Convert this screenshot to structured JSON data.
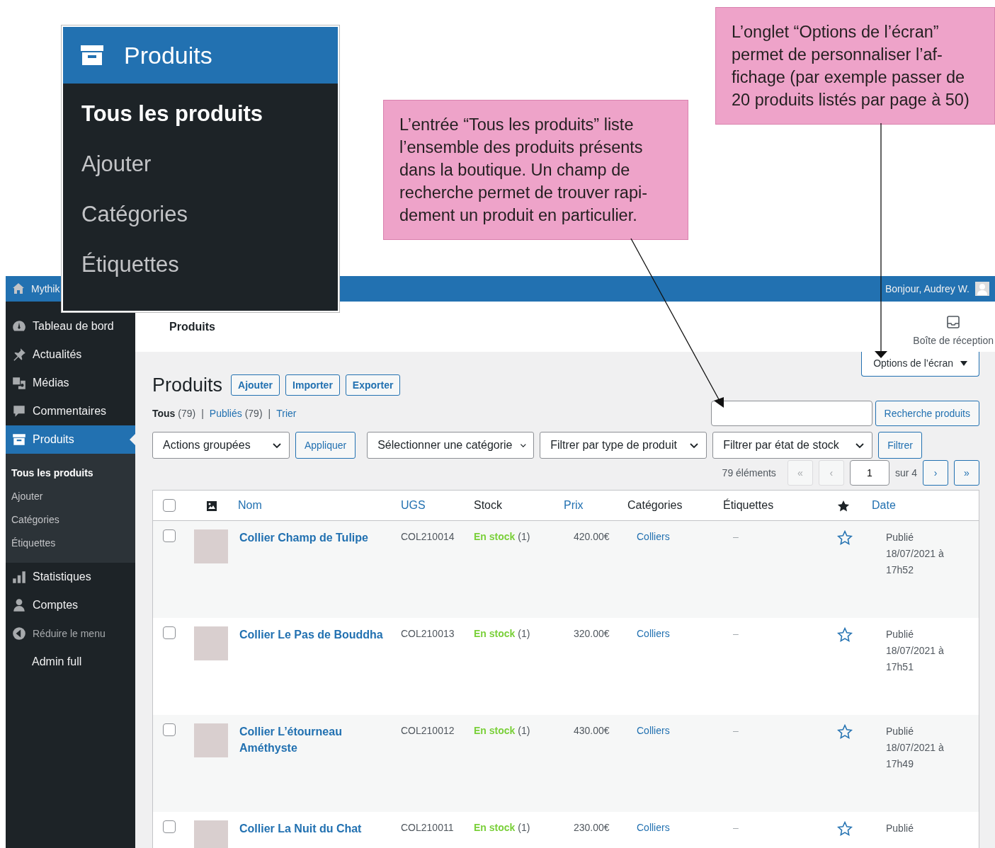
{
  "callouts": [
    {
      "lines": [
        "L’entrée “Tous les produits” liste",
        "l’ensemble des produits présents",
        "dans la boutique. Un champ de",
        "recherche permet de trouver rapi-",
        "dement un produit en particulier."
      ]
    },
    {
      "lines": [
        "L’onglet “Options de l’écran”",
        "permet de personnaliser l’af-",
        "fichage (par exemple passer de",
        "20 produits listés par page à 50)"
      ]
    }
  ],
  "menu_inset": {
    "title": "Produits",
    "items": [
      {
        "label": "Tous les produits",
        "selected": true
      },
      {
        "label": "Ajouter",
        "selected": false
      },
      {
        "label": "Catégories",
        "selected": false
      },
      {
        "label": "Étiquettes",
        "selected": false
      }
    ]
  },
  "admin_bar": {
    "site": "Mythik",
    "greeting": "Bonjour, Audrey W."
  },
  "sidebar": {
    "items": [
      {
        "label": "Tableau de bord",
        "kind": "item",
        "selected": false
      },
      {
        "label": "Actualités",
        "kind": "item",
        "selected": false
      },
      {
        "label": "Médias",
        "kind": "item",
        "selected": false
      },
      {
        "label": "Commentaires",
        "kind": "item",
        "selected": false
      },
      {
        "label": "Produits",
        "kind": "item",
        "selected": true,
        "children": [
          {
            "label": "Tous les produits",
            "selected": true
          },
          {
            "label": "Ajouter",
            "selected": false
          },
          {
            "label": "Catégories",
            "selected": false
          },
          {
            "label": "Étiquettes",
            "selected": false
          }
        ]
      },
      {
        "label": "Statistiques",
        "kind": "item",
        "selected": false
      },
      {
        "label": "Comptes",
        "kind": "item",
        "selected": false
      },
      {
        "label": "Réduire le menu",
        "kind": "collapse",
        "selected": false
      },
      {
        "label": "Admin full",
        "kind": "plain",
        "selected": false
      }
    ]
  },
  "header": {
    "title": "Produits",
    "inbox": "Boîte de réception"
  },
  "screen_options": "Options de l’écran",
  "page_title": "Produits",
  "title_buttons": [
    "Ajouter",
    "Importer",
    "Exporter"
  ],
  "views_separator": "|",
  "views": [
    {
      "label": "Tous",
      "count": "(79)",
      "selected": true
    },
    {
      "label": "Publiés",
      "count": "(79)",
      "selected": false
    },
    {
      "label": "Trier",
      "selected": false
    }
  ],
  "search": {
    "button": "Recherche produits"
  },
  "filters": {
    "bulk": "Actions groupées",
    "apply": "Appliquer",
    "selects": [
      "Sélectionner une catégorie",
      "Filtrer par type de produit",
      "Filtrer par état de stock"
    ],
    "filter": "Filtrer"
  },
  "pagination": {
    "count": "79 éléments",
    "first": "«",
    "prev": "‹",
    "page": "1",
    "of": "sur 4",
    "next": "›",
    "last": "»",
    "first_disabled": true,
    "prev_disabled": true
  },
  "table": {
    "all_checked": false,
    "columns": [
      {
        "kind": "check"
      },
      {
        "kind": "image"
      },
      {
        "label": "Nom",
        "sortable": true
      },
      {
        "label": "UGS",
        "sortable": true
      },
      {
        "label": "Stock",
        "sortable": false
      },
      {
        "label": "Prix",
        "sortable": true
      },
      {
        "label": "Catégories",
        "sortable": false
      },
      {
        "label": "Étiquettes",
        "sortable": false
      },
      {
        "kind": "featured"
      },
      {
        "label": "Date",
        "sortable": true
      }
    ],
    "rows": [
      {
        "checked": false,
        "name": "Collier Champ de Tulipe",
        "sku": "COL210014",
        "stock": "En stock",
        "qty": "(1)",
        "price": "420.00€",
        "category": "Colliers",
        "tags": "–",
        "featured": false,
        "status": "Publié",
        "date": "18/07/2021 à 17h52"
      },
      {
        "checked": false,
        "name": "Collier Le Pas de Bouddha",
        "sku": "COL210013",
        "stock": "En stock",
        "qty": "(1)",
        "price": "320.00€",
        "category": "Colliers",
        "tags": "–",
        "featured": false,
        "status": "Publié",
        "date": "18/07/2021 à 17h51"
      },
      {
        "checked": false,
        "name": "Collier L’étourneau Améthyste",
        "sku": "COL210012",
        "stock": "En stock",
        "qty": "(1)",
        "price": "430.00€",
        "category": "Colliers",
        "tags": "–",
        "featured": false,
        "status": "Publié",
        "date": "18/07/2021 à 17h49"
      },
      {
        "checked": false,
        "name": "Collier La Nuit du Chat",
        "sku": "COL210011",
        "stock": "En stock",
        "qty": "(1)",
        "price": "230.00€",
        "category": "Colliers",
        "tags": "–",
        "featured": false,
        "status": "Publié"
      }
    ]
  }
}
